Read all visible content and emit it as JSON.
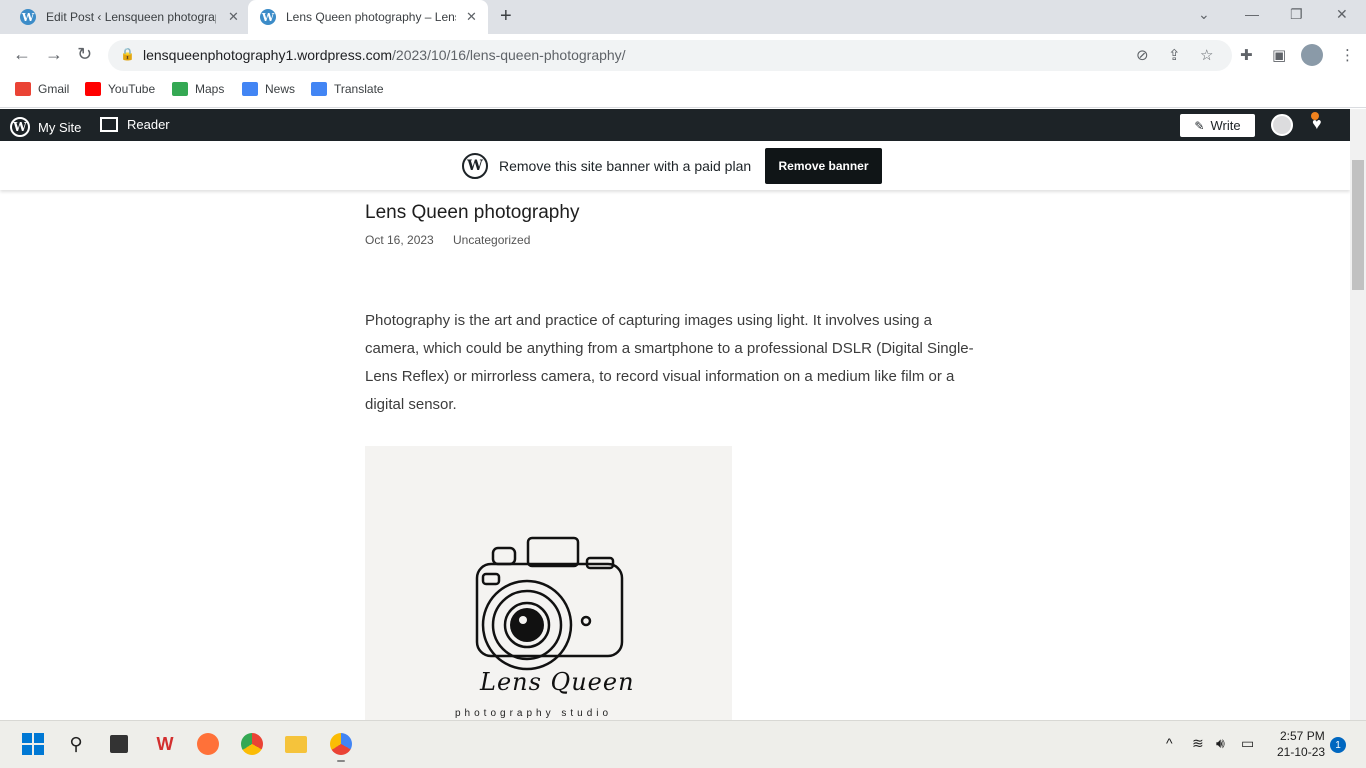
{
  "browser": {
    "tabs": [
      {
        "title": "Edit Post ‹ Lensqueen photograp",
        "active": false
      },
      {
        "title": "Lens Queen photography – Lens",
        "active": true
      }
    ],
    "url_domain": "lensqueenphotography1.wordpress.com",
    "url_path": "/2023/10/16/lens-queen-photography/",
    "bookmarks": [
      {
        "label": "Gmail",
        "icon": "gmail-icon",
        "color": "#ea4335"
      },
      {
        "label": "YouTube",
        "icon": "youtube-icon",
        "color": "#ff0000"
      },
      {
        "label": "Maps",
        "icon": "maps-icon",
        "color": "#34a853"
      },
      {
        "label": "News",
        "icon": "news-icon",
        "color": "#4285f4"
      },
      {
        "label": "Translate",
        "icon": "translate-icon",
        "color": "#4285f4"
      }
    ]
  },
  "adminbar": {
    "my_site": "My Site",
    "reader": "Reader",
    "write": "Write"
  },
  "banner": {
    "text": "Remove this site banner with a paid plan",
    "button": "Remove banner"
  },
  "post": {
    "title": "Lens Queen photography",
    "date": "Oct 16, 2023",
    "category": "Uncategorized",
    "body": "Photography is the art and practice of capturing images using light. It involves using a camera, which could be anything from a smartphone to a professional DSLR (Digital Single-Lens Reflex) or mirrorless camera, to record visual information on a medium like film or a digital sensor.",
    "image_title": "Lens Queen",
    "image_subtitle": "photography studio"
  },
  "taskbar": {
    "time": "2:57 PM",
    "date": "21-10-23",
    "notification_count": "1"
  }
}
